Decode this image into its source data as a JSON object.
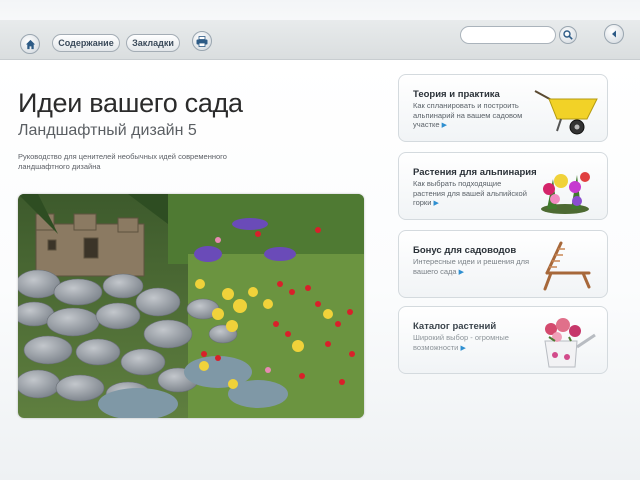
{
  "toolbar": {
    "home_icon": "home-icon",
    "contents_label": "Содержание",
    "bookmarks_label": "Закладки",
    "print_icon": "print-icon",
    "search_placeholder": "",
    "search_icon": "search-icon",
    "exit_icon": "exit-icon"
  },
  "header": {
    "title": "Идеи вашего сада",
    "subtitle": "Ландшафтный дизайн 5",
    "description": "Руководство для ценителей необычных идей современного ландшафтного дизайна"
  },
  "cards": [
    {
      "title": "Теория и практика",
      "text": "Как спланировать и построить альпинарий на вашем садовом участке",
      "image": "wheelbarrow"
    },
    {
      "title": "Растения для альпинария",
      "text": "Как выбрать подходящие растения для вашей альпийской горки",
      "image": "flower-bouquet"
    },
    {
      "title": "Бонус для садоводов",
      "text": "Интересные идеи и решения для вашего сада",
      "image": "lounge-chair"
    },
    {
      "title": "Каталог растений",
      "text": "Широкий выбор - огромные возможности",
      "image": "watering-can"
    }
  ],
  "colors": {
    "accent": "#2f8fd0",
    "title": "#2b2b2b"
  }
}
